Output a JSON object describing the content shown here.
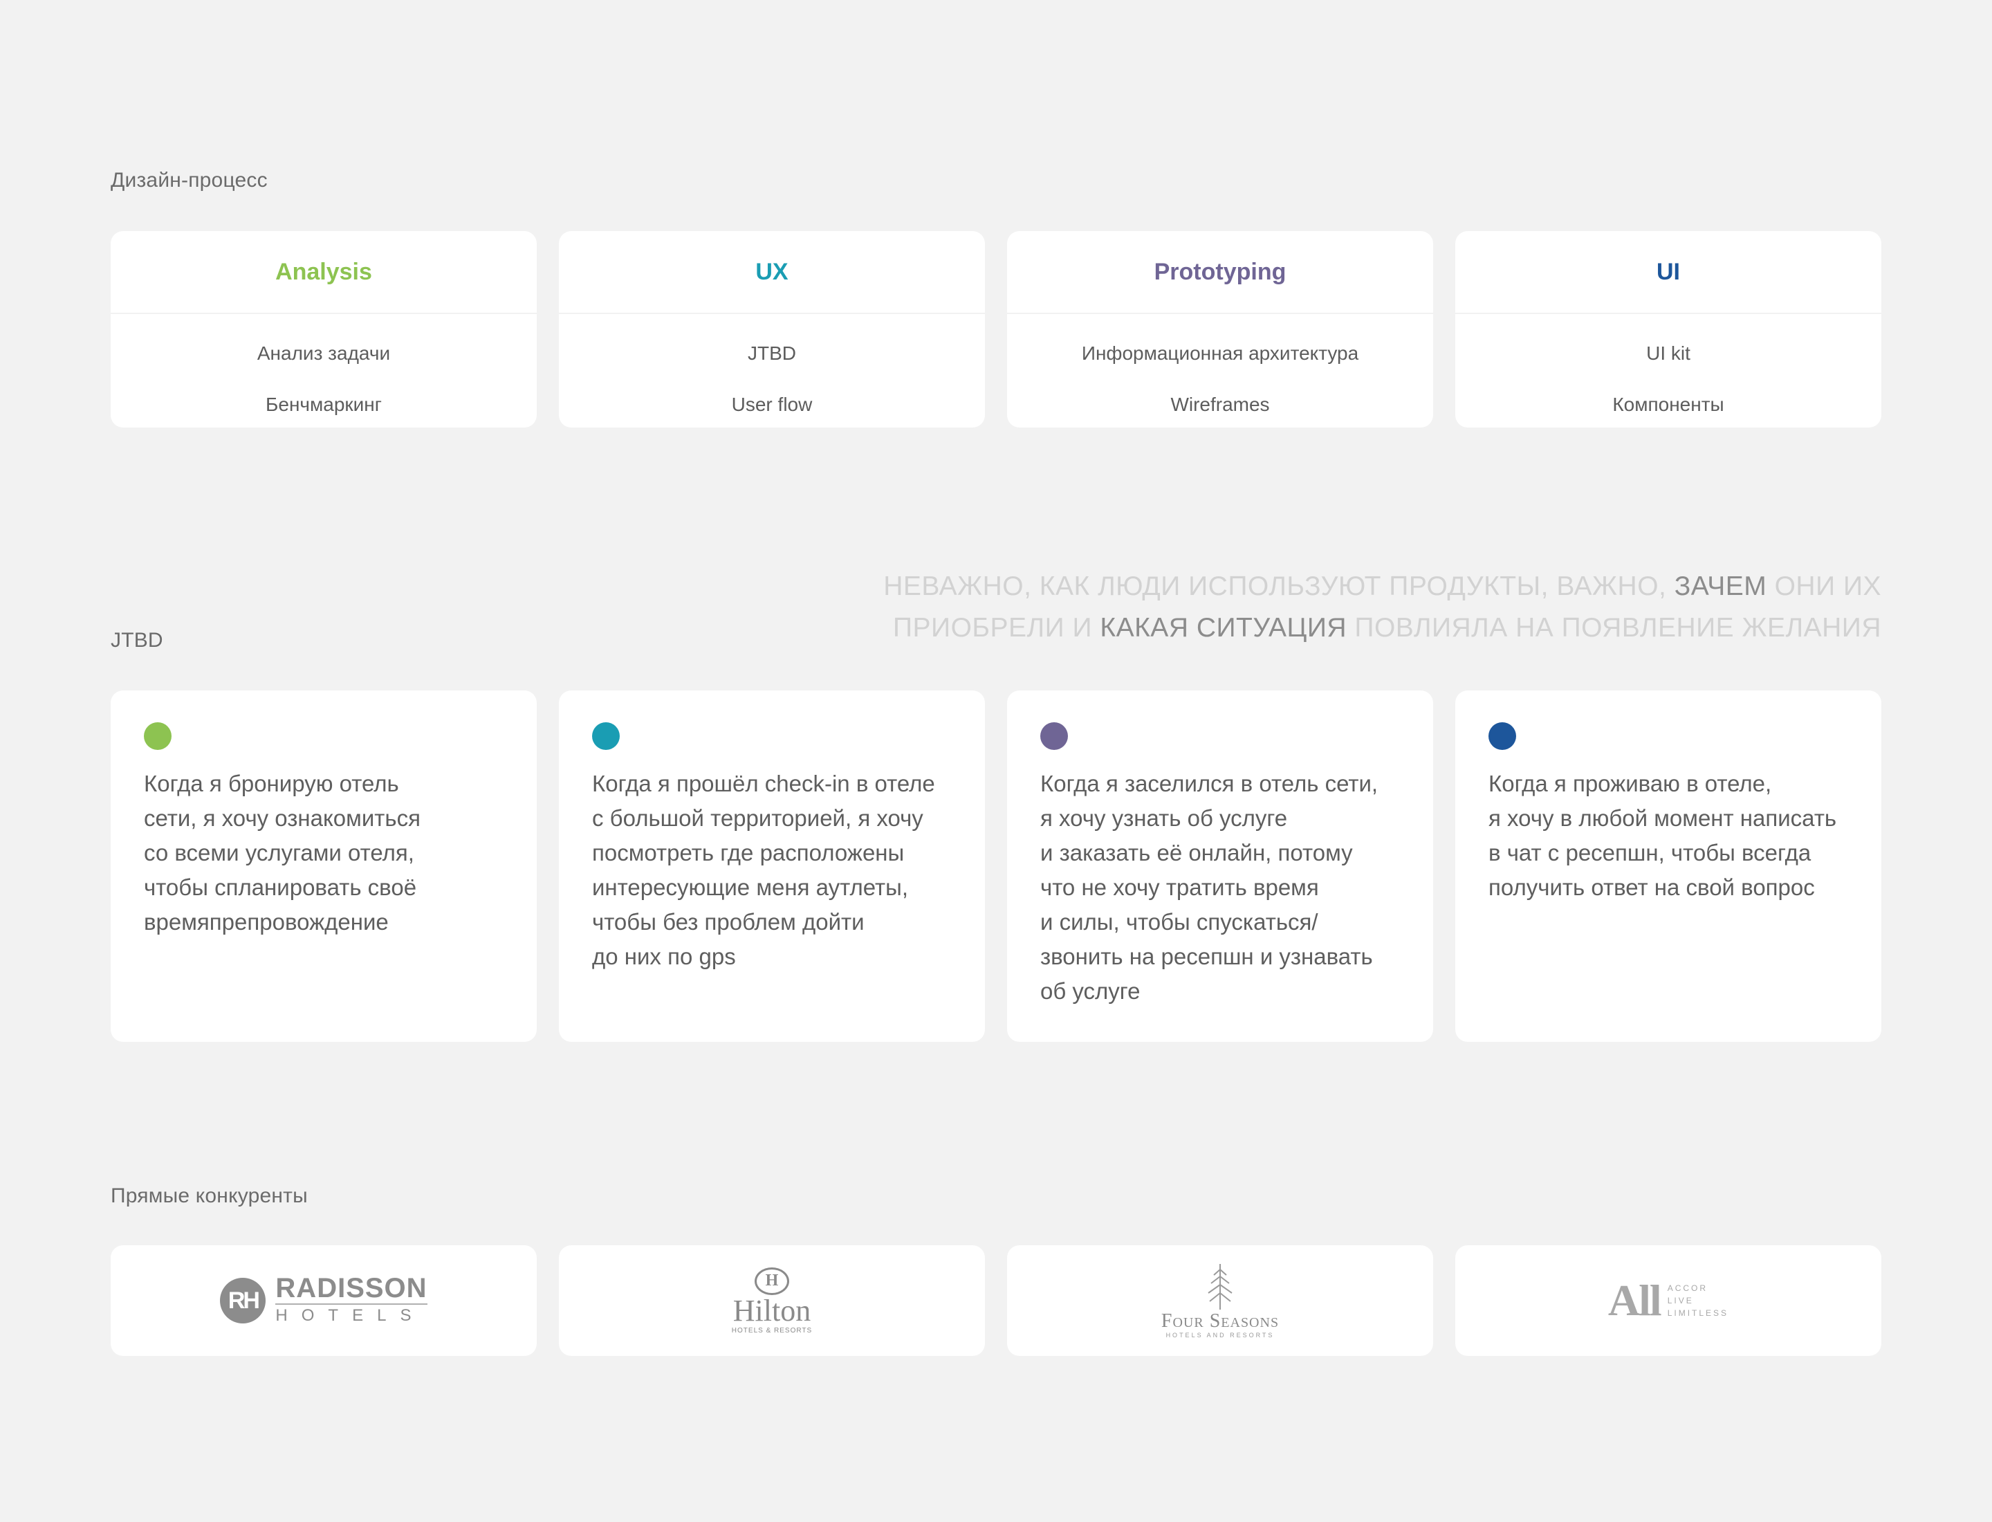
{
  "process": {
    "label": "Дизайн-процесс",
    "stages": [
      {
        "title": "Analysis",
        "color": "#8dc351",
        "items": [
          "Анализ задачи",
          "Бенчмаркинг"
        ]
      },
      {
        "title": "UX",
        "color": "#1a9db3",
        "items": [
          "JTBD",
          "User flow"
        ]
      },
      {
        "title": "Prototyping",
        "color": "#6f6595",
        "items": [
          "Информационная архитектура",
          "Wireframes"
        ]
      },
      {
        "title": "UI",
        "color": "#1d569b",
        "items": [
          "UI kit",
          "Компоненты"
        ]
      }
    ]
  },
  "quote": {
    "part1": "Неважно, как люди используют продукты, важно, ",
    "emphasis1": "зачем",
    "part2": " они их приобрели и ",
    "emphasis2": "какая ситуация",
    "part3": " повлияла на появление желания"
  },
  "jtbd": {
    "label": "JTBD",
    "cards": [
      {
        "color": "#8dc351",
        "text": "Когда я бронирую отель\nсети, я хочу ознакомиться\nсо всеми услугами отеля,\nчтобы спланировать своё\nвремяпрепровождение"
      },
      {
        "color": "#1a9db3",
        "text": "Когда я прошёл check-in в отеле\nс большой территорией, я хочу\nпосмотреть где расположены\nинтересующие меня аутлеты,\nчтобы без проблем дойти\nдо них по gps"
      },
      {
        "color": "#6f6595",
        "text": "Когда я заселился в отель сети,\nя хочу узнать об услуге\nи заказать её онлайн, потому\nчто не хочу тратить время\nи силы, чтобы спускаться/\nзвонить на ресепшн и узнавать\nоб услуге"
      },
      {
        "color": "#1d569b",
        "text": "Когда я проживаю в отеле,\nя хочу в любой момент написать\nв чат с ресепшн, чтобы всегда\nполучить ответ на свой вопрос"
      }
    ]
  },
  "competitors": {
    "label": "Прямые конкуренты",
    "radisson": {
      "mark": "RH",
      "name": "RADISSON",
      "sub": "HOTELS"
    },
    "hilton": {
      "mark": "H",
      "name": "Hilton",
      "sub": "HOTELS & RESORTS"
    },
    "fourseasons": {
      "name": "Four Seasons",
      "sub": "HOTELS AND RESORTS"
    },
    "accor": {
      "mark": "All",
      "lines": [
        "ACCOR",
        "LIVE",
        "LIMITLESS"
      ]
    }
  }
}
